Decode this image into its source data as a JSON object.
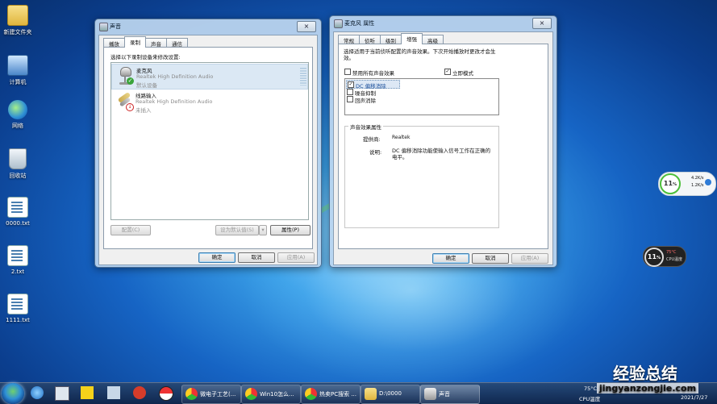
{
  "desktop": {
    "icons": [
      {
        "label": "新建文件夹",
        "icon": "folder-icon"
      },
      {
        "label": "计算机",
        "icon": "computer-icon"
      },
      {
        "label": "网络",
        "icon": "network-icon"
      },
      {
        "label": "回收站",
        "icon": "recycle-bin-icon"
      },
      {
        "label": "0000.txt",
        "icon": "text-file-icon"
      },
      {
        "label": "2.txt",
        "icon": "text-file-icon"
      },
      {
        "label": "1111.txt",
        "icon": "text-file-icon"
      }
    ]
  },
  "sound_dialog": {
    "title": "声音",
    "close": "×",
    "tabs": [
      "播放",
      "录制",
      "声音",
      "通信"
    ],
    "active_tab": "录制",
    "instruction": "选择以下录制设备来修改设置:",
    "devices": [
      {
        "name": "麦克风",
        "driver": "Realtek High Definition Audio",
        "status": "默认设备"
      },
      {
        "name": "线路输入",
        "driver": "Realtek High Definition Audio",
        "status": "未插入"
      }
    ],
    "configure_button": "配置(C)",
    "set_default_button": "设为默认值(S)",
    "dropdown_arrow": "▾",
    "properties_button": "属性(P)",
    "ok_button": "确定",
    "cancel_button": "取消",
    "apply_button": "应用(A)"
  },
  "mic_properties": {
    "title": "麦克风 属性",
    "close": "×",
    "tabs": [
      "常规",
      "侦听",
      "级别",
      "增强",
      "高级"
    ],
    "active_tab": "增强",
    "description": "选择适用于当前侦听配置的声音效果。下次开始播放时更改才会生效。",
    "disable_all_label": "禁用所有声音效果",
    "disable_all_checked": false,
    "immediate_mode_label": "立即模式",
    "immediate_mode_checked": true,
    "effects": [
      {
        "label": "DC 偏移消除",
        "checked": true
      },
      {
        "label": "噪音抑制",
        "checked": false
      },
      {
        "label": "回声消除",
        "checked": false
      }
    ],
    "group_title": "声音效果属性",
    "provider_label": "提供商:",
    "provider_value": "Realtek",
    "desc_label": "说明:",
    "desc_value": "DC 偏移消除功能使输入信号工作在正确的电平。",
    "ok_button": "确定",
    "cancel_button": "取消",
    "apply_button": "应用(A)"
  },
  "gadgets": {
    "net_percent": "11",
    "net_percent_unit": "%",
    "upload": "4.2K/s",
    "download": "1.2K/s",
    "cpu_percent": "11",
    "cpu_percent_unit": "%",
    "cpu_temp": "75°C",
    "cpu_temp_label": "CPU温度"
  },
  "taskbar": {
    "items": [
      {
        "label": "微电子工艺(...",
        "icon": "chrome-icon"
      },
      {
        "label": "Win10怎么...",
        "icon": "chrome-icon"
      },
      {
        "label": "热卖PC搜索 ...",
        "icon": "chrome-icon"
      },
      {
        "label": "D:\\0000",
        "icon": "folder-icon"
      },
      {
        "label": "声音",
        "icon": "speaker-icon"
      }
    ],
    "tray_temp": "75°C",
    "tray_cpu_label": "CPU温度",
    "date": "2021/7/27"
  },
  "watermark": {
    "cn": "经验总结",
    "url": "jingyanzongjie.com"
  }
}
